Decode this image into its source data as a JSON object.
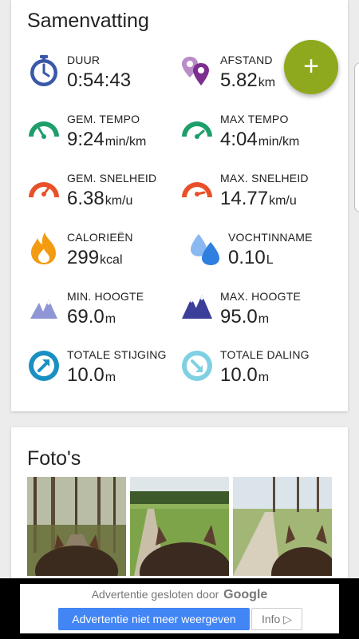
{
  "summary": {
    "title": "Samenvatting",
    "stats": [
      {
        "label": "DUUR",
        "value": "0:54:43",
        "unit": "",
        "icon": "stopwatch-icon"
      },
      {
        "label": "AFSTAND",
        "value": "5.82",
        "unit": "km",
        "icon": "map-pins-icon"
      },
      {
        "label": "GEM. TEMPO",
        "value": "9:24",
        "unit": "min/km",
        "icon": "gauge-icon"
      },
      {
        "label": "MAX TEMPO",
        "value": "4:04",
        "unit": "min/km",
        "icon": "gauge-icon"
      },
      {
        "label": "GEM. SNELHEID",
        "value": "6.38",
        "unit": "km/u",
        "icon": "speedometer-icon"
      },
      {
        "label": "MAX. SNELHEID",
        "value": "14.77",
        "unit": "km/u",
        "icon": "speedometer-icon"
      },
      {
        "label": "CALORIEËN",
        "value": "299",
        "unit": "kcal",
        "icon": "flame-icon"
      },
      {
        "label": "VOCHTINNAME",
        "value": "0.10",
        "unit": "L",
        "icon": "water-drops-icon"
      },
      {
        "label": "MIN. HOOGTE",
        "value": "69.0",
        "unit": "m",
        "icon": "mountains-icon"
      },
      {
        "label": "MAX. HOOGTE",
        "value": "95.0",
        "unit": "m",
        "icon": "mountains-icon"
      },
      {
        "label": "TOTALE STIJGING",
        "value": "10.0",
        "unit": "m",
        "icon": "ascent-arrow-icon"
      },
      {
        "label": "TOTALE DALING",
        "value": "10.0",
        "unit": "m",
        "icon": "descent-arrow-icon"
      }
    ]
  },
  "fab": {
    "label": "+"
  },
  "photos": {
    "title": "Foto's"
  },
  "ad": {
    "closed_text": "Advertentie gesloten door",
    "brand": "Google",
    "button_label": "Advertentie niet meer weergeven",
    "info_label": "Info ▷"
  },
  "colors": {
    "accent": "#8ea91d",
    "stopwatch": "#3a57a8",
    "pins": "#9b59b6",
    "gauge": "#1e9e6b",
    "speed": "#e8502a",
    "flame": "#f39c12",
    "water": "#3b8ee6",
    "mountain": "#3b3f9a",
    "ascent": "#1a8fc2",
    "descent": "#7fd0e3",
    "ad_button": "#4285f4"
  }
}
